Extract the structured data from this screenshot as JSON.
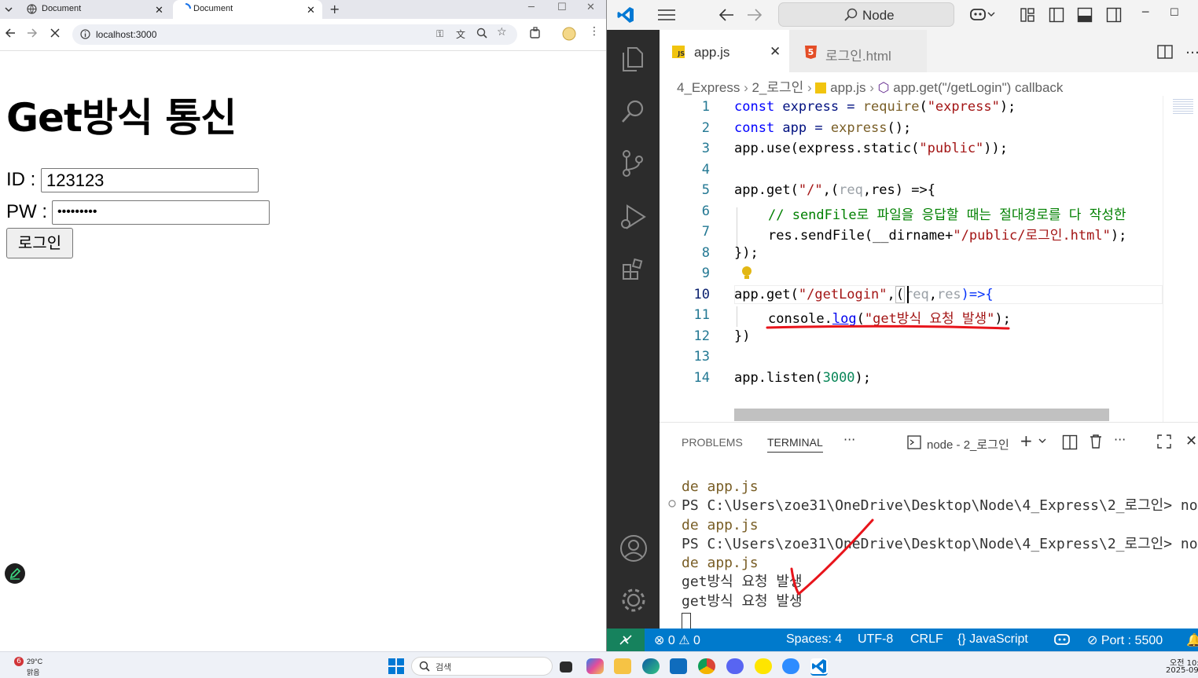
{
  "browser": {
    "tabs": [
      {
        "title": "Document"
      },
      {
        "title": "Document"
      }
    ],
    "new_tab": "+",
    "url": "localhost:3000",
    "page": {
      "title": "Get방식 통신",
      "id_label": "ID :",
      "id_value": "123123",
      "pw_label": "PW :",
      "pw_mask": "•••••••••",
      "login_button": "로그인"
    }
  },
  "vscode": {
    "command_center": "Node",
    "tabs": [
      {
        "label": "app.js",
        "icon": "JS"
      },
      {
        "label": "로그인.html",
        "icon": "5"
      }
    ],
    "breadcrumb": [
      "4_Express",
      "2_로그인",
      "app.js",
      "app.get(\"/getLogin\") callback"
    ],
    "code_lines": [
      {
        "n": "1"
      },
      {
        "n": "2"
      },
      {
        "n": "3"
      },
      {
        "n": "4"
      },
      {
        "n": "5"
      },
      {
        "n": "6"
      },
      {
        "n": "7"
      },
      {
        "n": "8"
      },
      {
        "n": "9"
      },
      {
        "n": "10"
      },
      {
        "n": "11"
      },
      {
        "n": "12"
      },
      {
        "n": "13"
      },
      {
        "n": "14"
      }
    ],
    "code": {
      "l1": [
        "const",
        " express = ",
        "require",
        "(",
        "\"express\"",
        ");"
      ],
      "l2": [
        "const",
        " app = ",
        "express",
        "();"
      ],
      "l3": [
        "app.use(express.static(",
        "\"public\"",
        "));"
      ],
      "l5": [
        "app.get(",
        "\"/\"",
        ",(",
        "req",
        ",",
        "res",
        ") =>{"
      ],
      "l6": "// sendFile로 파일을 응답할 때는 절대경로를 다 작성한",
      "l7": [
        "res.sendFile(__dirname+",
        "\"/public/로그인.html\"",
        ");"
      ],
      "l8": "});",
      "l10": [
        "app.get(",
        "\"/getLogin\"",
        ",",
        "(",
        "req",
        ",",
        "res",
        ")=>{"
      ],
      "l11": [
        "console.",
        "log",
        "(",
        "\"get방식 요청 발생\"",
        ");"
      ],
      "l12": "})",
      "l14": [
        "app.listen(",
        "3000",
        ");"
      ]
    },
    "panel": {
      "tabs": [
        "PROBLEMS",
        "TERMINAL"
      ],
      "terminal_name": "node - 2_로그인",
      "lines": [
        "de app.js",
        "PS C:\\Users\\zoe31\\OneDrive\\Desktop\\Node\\4_Express\\2_로그인> no",
        "de app.js",
        "PS C:\\Users\\zoe31\\OneDrive\\Desktop\\Node\\4_Express\\2_로그인> no",
        "de app.js",
        "get방식 요청 발생",
        "get방식 요청 발생"
      ]
    },
    "status": {
      "errors": "0",
      "warnings": "0",
      "spaces": "Spaces: 4",
      "encoding": "UTF-8",
      "eol": "CRLF",
      "language": "JavaScript",
      "port": "Port : 5500"
    }
  },
  "taskbar": {
    "weather_temp": "29°C",
    "weather_text": "맑음",
    "weather_badge": "6",
    "search_placeholder": "검색",
    "clock_time": "오전 10:",
    "clock_date": "2025-09-"
  },
  "colors": {
    "vscode_blue": "#007acc",
    "activity_bar": "#2c2c2c",
    "annotation_red": "#e8141b"
  }
}
